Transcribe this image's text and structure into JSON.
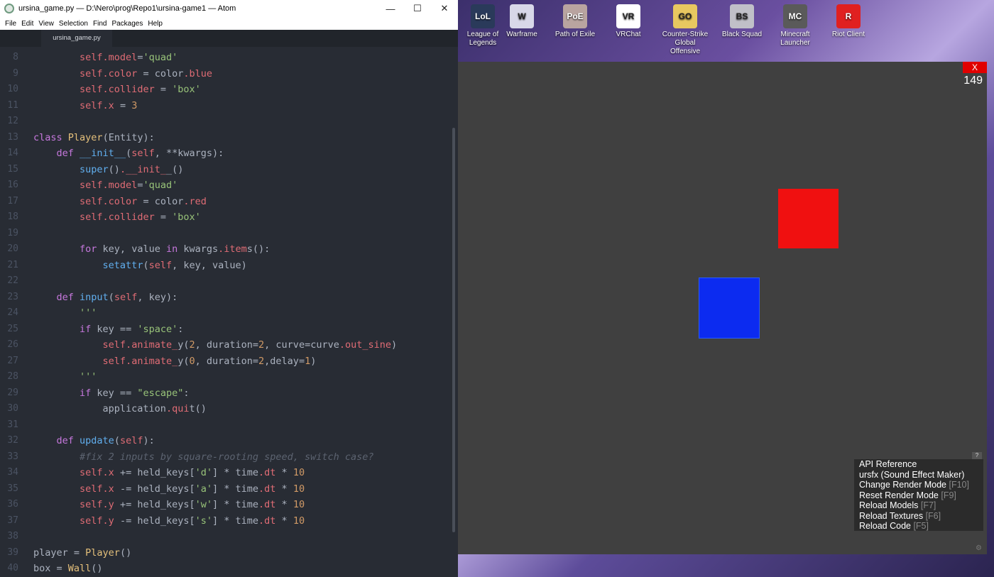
{
  "atom": {
    "window_title": "ursina_game.py — D:\\Nero\\prog\\Repo1\\ursina-game1 — Atom",
    "menu": [
      "File",
      "Edit",
      "View",
      "Selection",
      "Find",
      "Packages",
      "Help"
    ],
    "tab": "ursina_game.py",
    "code_lines": [
      {
        "n": "8",
        "text": "        self.model='quad'"
      },
      {
        "n": "9",
        "text": "        self.color = color.blue"
      },
      {
        "n": "10",
        "text": "        self.collider = 'box'"
      },
      {
        "n": "11",
        "text": "        self.x = 3"
      },
      {
        "n": "12",
        "text": ""
      },
      {
        "n": "13",
        "text": "class Player(Entity):"
      },
      {
        "n": "14",
        "text": "    def __init__(self, **kwargs):"
      },
      {
        "n": "15",
        "text": "        super().__init__()"
      },
      {
        "n": "16",
        "text": "        self.model='quad'"
      },
      {
        "n": "17",
        "text": "        self.color = color.red"
      },
      {
        "n": "18",
        "text": "        self.collider = 'box'"
      },
      {
        "n": "19",
        "text": ""
      },
      {
        "n": "20",
        "text": "        for key, value in kwargs.items():"
      },
      {
        "n": "21",
        "text": "            setattr(self, key, value)"
      },
      {
        "n": "22",
        "text": ""
      },
      {
        "n": "23",
        "text": "    def input(self, key):"
      },
      {
        "n": "24",
        "text": "        '''"
      },
      {
        "n": "25",
        "text": "        if key == 'space':"
      },
      {
        "n": "26",
        "text": "            self.animate_y(2, duration=2, curve=curve.out_sine)"
      },
      {
        "n": "27",
        "text": "            self.animate_y(0, duration=2,delay=1)"
      },
      {
        "n": "28",
        "text": "        '''"
      },
      {
        "n": "29",
        "text": "        if key == \"escape\":"
      },
      {
        "n": "30",
        "text": "            application.quit()"
      },
      {
        "n": "31",
        "text": ""
      },
      {
        "n": "32",
        "text": "    def update(self):"
      },
      {
        "n": "33",
        "text": "        #fix 2 inputs by square-rooting speed, switch case?"
      },
      {
        "n": "34",
        "text": "        self.x += held_keys['d'] * time.dt * 10"
      },
      {
        "n": "35",
        "text": "        self.x -= held_keys['a'] * time.dt * 10"
      },
      {
        "n": "36",
        "text": "        self.y += held_keys['w'] * time.dt * 10"
      },
      {
        "n": "37",
        "text": "        self.y -= held_keys['s'] * time.dt * 10"
      },
      {
        "n": "38",
        "text": ""
      },
      {
        "n": "39",
        "text": "player = Player()"
      },
      {
        "n": "40",
        "text": "box = Wall()"
      }
    ]
  },
  "desktop_icons": [
    {
      "label": "League of Legends",
      "color": "#2a3a5a",
      "glyph": "LoL"
    },
    {
      "label": "Warframe",
      "color": "#d8d8e8",
      "glyph": "W"
    },
    {
      "label": "Path of Exile",
      "color": "#b9a4a0",
      "glyph": "PoE"
    },
    {
      "label": "VRChat",
      "color": "#ffffff",
      "glyph": "VR"
    },
    {
      "label": "Counter-Strike Global Offensive",
      "color": "#e8c860",
      "glyph": "GO"
    },
    {
      "label": "Black Squad",
      "color": "#c0c0c8",
      "glyph": "BS"
    },
    {
      "label": "Minecraft Launcher",
      "color": "#5a5a5a",
      "glyph": "MC"
    },
    {
      "label": "Riot Client",
      "color": "#e02020",
      "glyph": "R"
    }
  ],
  "game": {
    "close_label": "X",
    "fps": "149",
    "help_label": "?",
    "dev_menu": [
      {
        "label": "API Reference",
        "key": ""
      },
      {
        "label": "ursfx (Sound Effect Maker)",
        "key": ""
      },
      {
        "label": "Change Render Mode ",
        "key": "[F10]"
      },
      {
        "label": "Reset Render Mode ",
        "key": "[F9]"
      },
      {
        "label": "Reload Models ",
        "key": "[F7]"
      },
      {
        "label": "Reload Textures ",
        "key": "[F6]"
      },
      {
        "label": "Reload Code ",
        "key": "[F5]"
      }
    ],
    "colors": {
      "background": "#404040",
      "player": "#f01010",
      "wall": "#0c2bf0"
    }
  }
}
